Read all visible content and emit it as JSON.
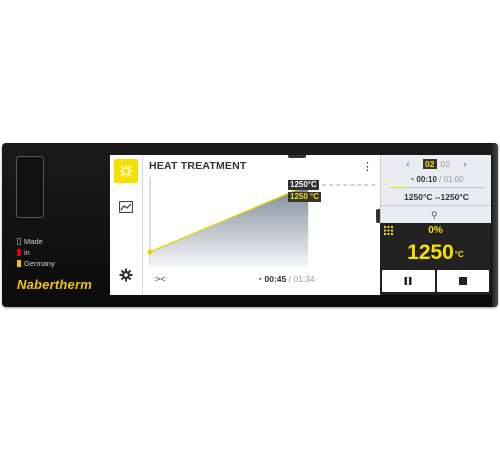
{
  "device": {
    "brand": "Nabertherm",
    "legend": [
      "Made",
      "in",
      "Germany"
    ],
    "flag_colors": [
      "#111111",
      "#dd0000",
      "#f2c500"
    ]
  },
  "sidebar": {
    "items": [
      {
        "name": "heat-icon",
        "active": true
      },
      {
        "name": "chart-icon",
        "active": false
      },
      {
        "name": "settings-gear-icon",
        "active": false
      }
    ],
    "accent": "#f6e000"
  },
  "main": {
    "title": "HEAT TREATMENT",
    "menu_icon": "⋮",
    "setpoint_tag": "1250°C",
    "actual_tag": "1250 °C",
    "collapse_icon": "><",
    "elapsed": "00:45",
    "separator": " / ",
    "total": "01:34"
  },
  "chart_data": {
    "type": "line",
    "series": [
      {
        "values": [
          [
            0,
            0
          ],
          [
            70,
            100
          ],
          [
            100,
            100
          ]
        ]
      }
    ]
  },
  "panel": {
    "segment_current": "02",
    "segment_total": "02",
    "prev_icon": "‹",
    "next_icon": "›",
    "segment_elapsed": "00:10",
    "time_separator": " / ",
    "segment_duration": "01:00",
    "temp_range": "1250°C --1250°C",
    "fan_icon": "⚲",
    "segment_progress": 0.17
  },
  "status": {
    "power": "0%",
    "temperature": "1250",
    "unit": "°C"
  },
  "controls": {
    "pause_icon": "pause-icon",
    "stop_icon": "stop-icon"
  }
}
